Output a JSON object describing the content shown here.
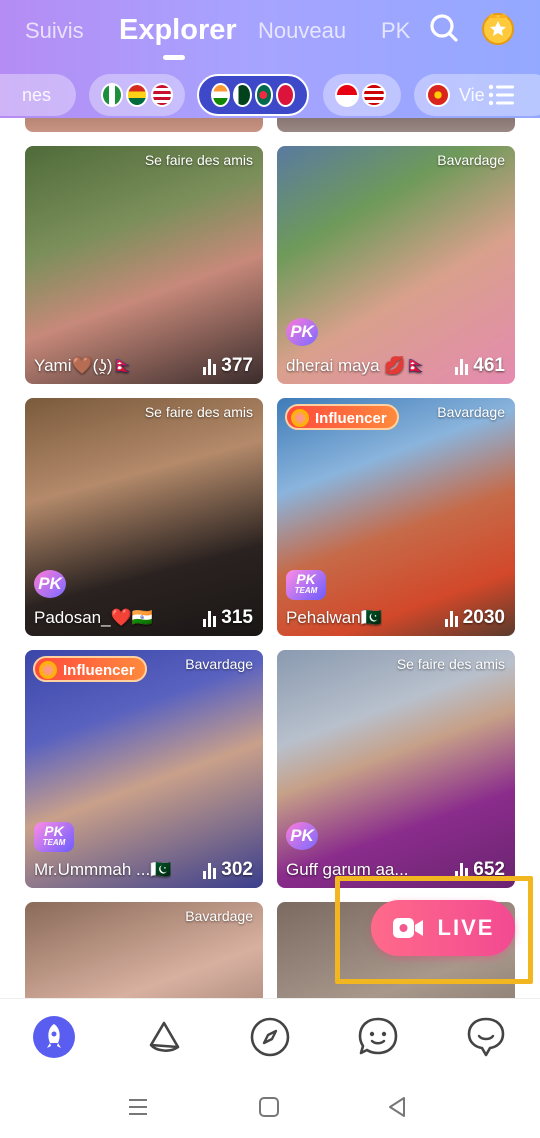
{
  "header": {
    "tabs": [
      {
        "label": "Suivis"
      },
      {
        "label": "Explorer"
      },
      {
        "label": "Nouveau"
      },
      {
        "label": "PK"
      }
    ],
    "active_tab": "Explorer",
    "icons": [
      "search-icon",
      "trophy-icon"
    ]
  },
  "filters": {
    "chips": [
      {
        "label": "nes"
      },
      {
        "flags": [
          "Nigeria",
          "Ghana",
          "USA"
        ]
      },
      {
        "flags": [
          "India",
          "Pakistan",
          "Bangladesh",
          "Nepal"
        ]
      },
      {
        "flags": [
          "Indonesia",
          "Malaysia"
        ]
      },
      {
        "flags": [
          "Vietnam"
        ],
        "label": "Vie"
      }
    ],
    "menu_icon": "list-menu-icon"
  },
  "streams": [
    {
      "tag": "Se faire des amis",
      "name": "Yami🤎(ʖ̯)🇳🇵",
      "viewers": "377"
    },
    {
      "tag": "Bavardage",
      "name": "dherai maya 💋🇳🇵",
      "viewers": "461",
      "badge": "PK"
    },
    {
      "tag": "Se faire des amis",
      "name": "Padosan_❤️🇮🇳",
      "viewers": "315",
      "badge": "PK"
    },
    {
      "tag": "Bavardage",
      "name": "Pehalwan🇵🇰",
      "viewers": "2030",
      "badge": "PK TEAM",
      "influencer": "Influencer"
    },
    {
      "tag": "Bavardage",
      "name": "Mr.Ummmah ...🇵🇰",
      "viewers": "302",
      "badge": "PK TEAM",
      "influencer": "Influencer"
    },
    {
      "tag": "Se faire des amis",
      "name": "Guff garum aa...",
      "viewers": "652",
      "badge": "PK"
    },
    {
      "tag": "Bavardage",
      "name": "",
      "viewers": ""
    },
    {
      "tag": "",
      "name": "",
      "viewers": ""
    }
  ],
  "live_button": {
    "label": "LIVE",
    "icon": "video-camera-icon"
  },
  "bottom_nav": [
    "rocket-icon",
    "bell-icon",
    "compass-icon",
    "chat-face-icon",
    "message-icon"
  ],
  "system_nav": [
    "recents-icon",
    "home-icon",
    "back-icon"
  ],
  "colors": {
    "accent": "#3d49c9",
    "live": "#f24a92",
    "highlight": "#f2b620"
  }
}
